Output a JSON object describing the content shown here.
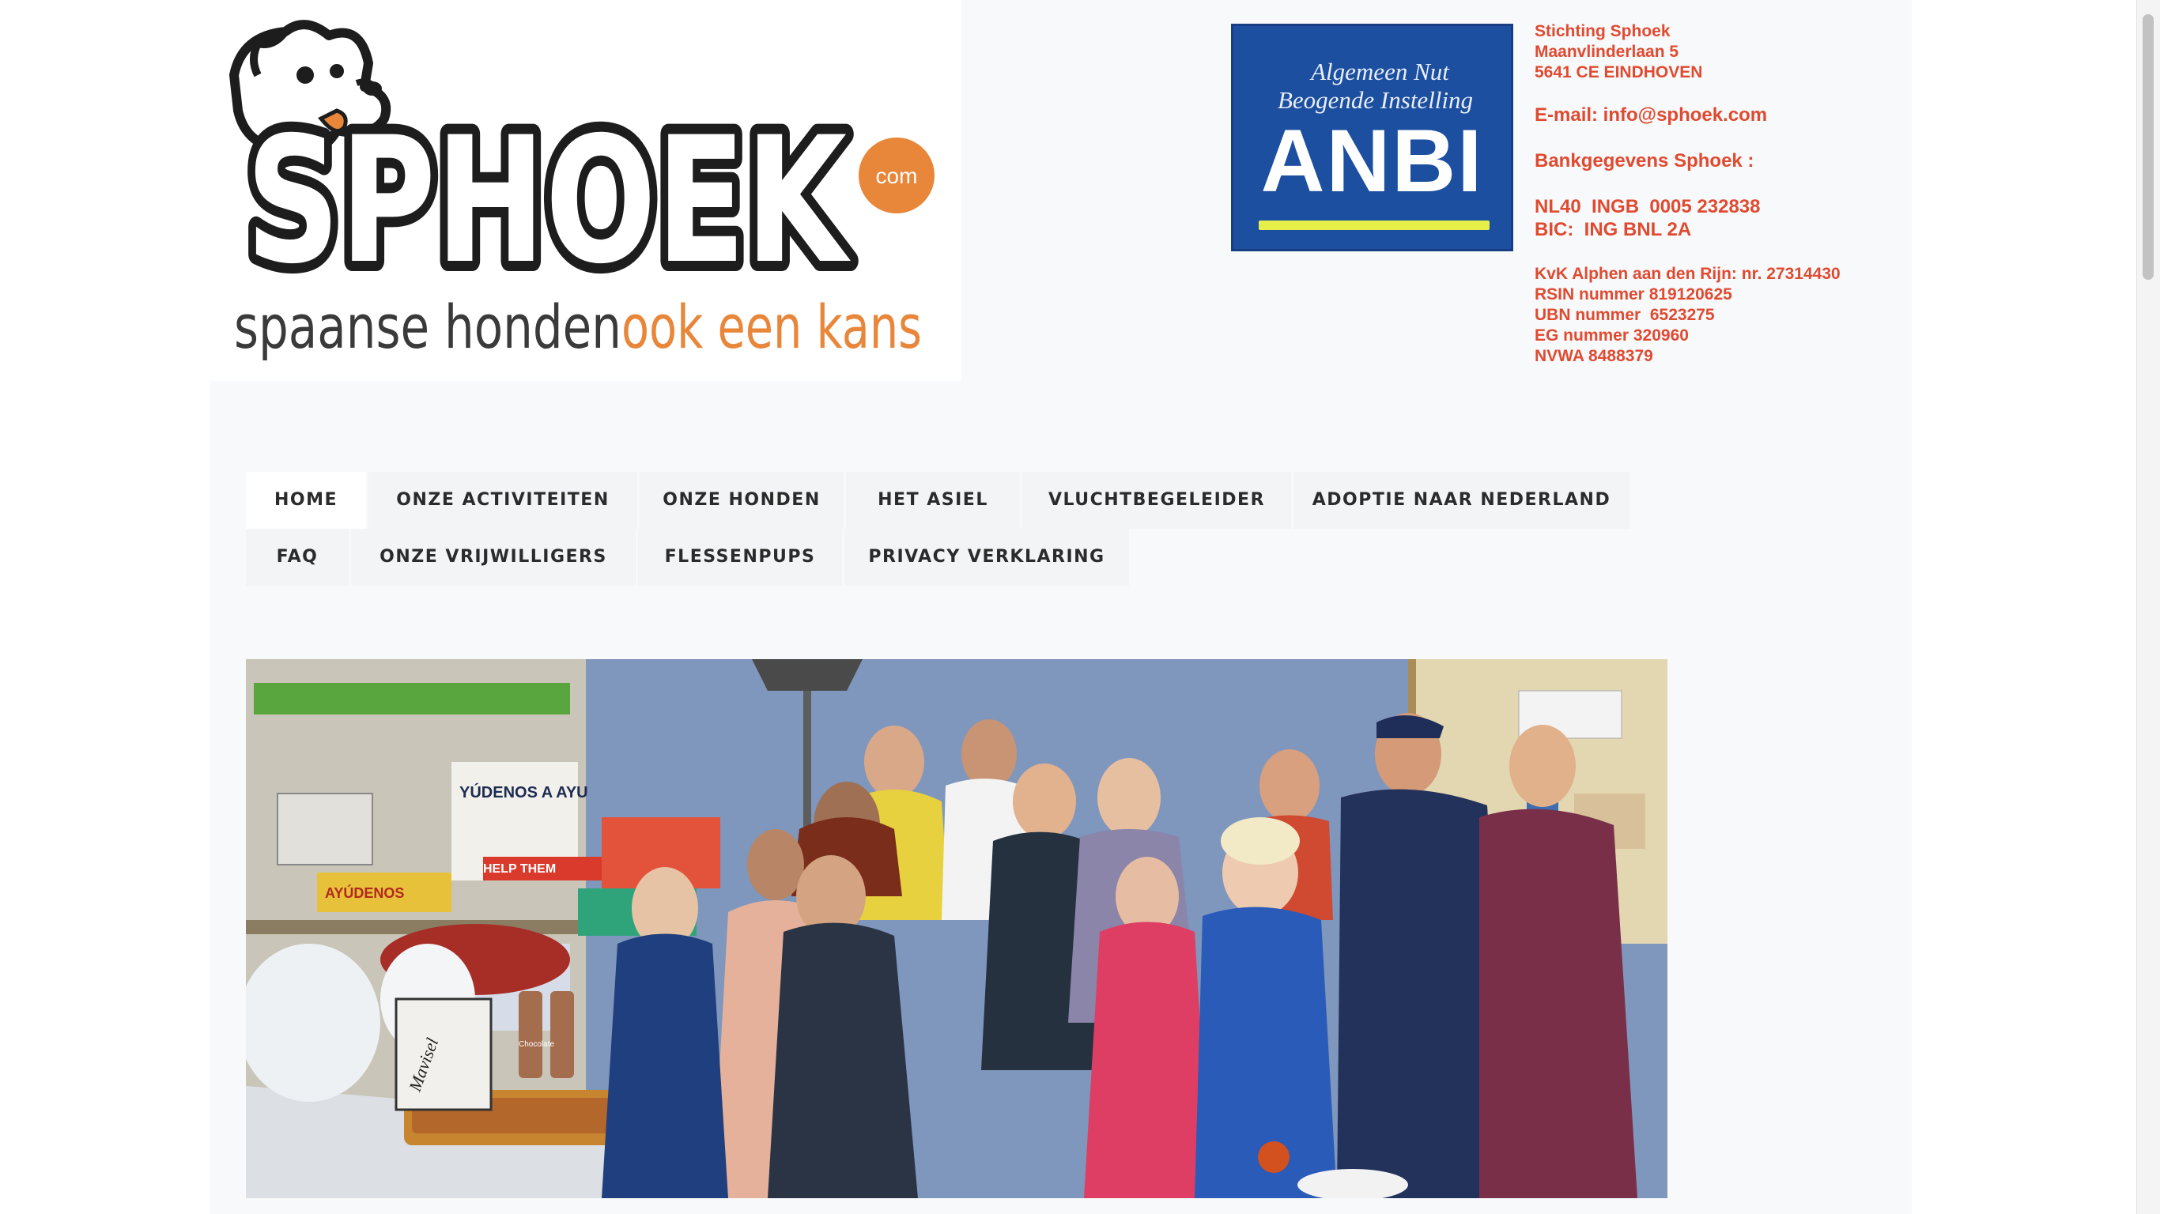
{
  "logo": {
    "wordmark": "SPHOEK",
    "com": "com",
    "tagline_dark": "spaanse honden",
    "tagline_orange": "ook een kans"
  },
  "anbi": {
    "line1": "Algemeen Nut",
    "line2": "Beogende Instelling",
    "big": "ANBI"
  },
  "contact": {
    "org": "Stichting Sphoek",
    "street": "Maanvlinderlaan 5",
    "city": "5641 CE EINDHOVEN",
    "email": "E-mail: info@sphoek.com",
    "bank_title": "Bankgegevens Sphoek :",
    "iban": "NL40  INGB  0005 232838",
    "bic": "BIC:  ING BNL 2A",
    "kvk": "KvK Alphen aan den Rijn: nr. 27314430",
    "rsin": "RSIN nummer 819120625",
    "ubn": "UBN nummer  6523275",
    "eg": "EG nummer 320960",
    "nvwa": "NVWA 8488379"
  },
  "nav": {
    "items": [
      {
        "label": "HOME"
      },
      {
        "label": "ONZE ACTIVITEITEN"
      },
      {
        "label": "ONZE HONDEN"
      },
      {
        "label": "HET ASIEL"
      },
      {
        "label": "VLUCHTBEGELEIDER"
      },
      {
        "label": "ADOPTIE NAAR NEDERLAND"
      },
      {
        "label": "FAQ"
      },
      {
        "label": "ONZE VRIJWILLIGERS"
      },
      {
        "label": "FLESSENPUPS"
      },
      {
        "label": "PRIVACY VERKLARING"
      }
    ],
    "active": "HOME"
  },
  "hero": {
    "poster_text_1": "YÚDENOS A AYU",
    "poster_text_2": "AYÚDENOS",
    "poster_text_3": "HELP THEM",
    "bag_text": "Mavisel",
    "bottle_label": "Chocolate"
  },
  "colors": {
    "accent_orange": "#e8863a",
    "contact_red": "#e04a30",
    "anbi_blue": "#1c4fa0",
    "nav_text": "#2b2b2b"
  }
}
